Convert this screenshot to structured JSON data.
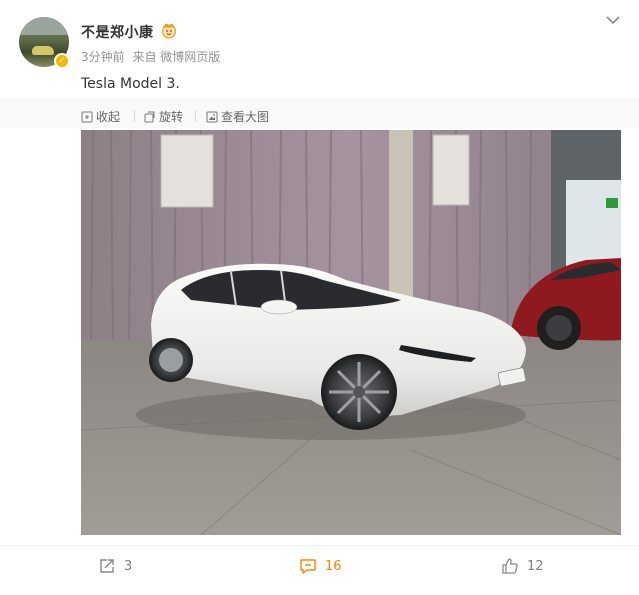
{
  "post": {
    "author": "不是郑小康",
    "time": "3分钟前",
    "source": "来自 微博网页版",
    "text": "Tesla Model 3."
  },
  "media_toolbar": {
    "collapse": "收起",
    "rotate": "旋转",
    "view_large": "查看大图"
  },
  "actions": {
    "reposts": "3",
    "comments": "16",
    "likes": "12"
  },
  "icons": [
    "chevron-down-icon",
    "collapse-icon",
    "rotate-icon",
    "view-large-icon",
    "repost-icon",
    "comment-icon",
    "like-icon",
    "verified-icon",
    "crown-badge-icon"
  ],
  "colors": {
    "accent": "#ff8200",
    "verified": "#f7b500"
  }
}
